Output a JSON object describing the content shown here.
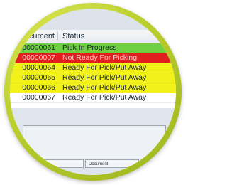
{
  "table": {
    "columns": [
      "ocument",
      "Status"
    ],
    "rows": [
      {
        "document": "00000061",
        "status": "Pick In Progress",
        "color": "#6fcf43"
      },
      {
        "document": "00000007",
        "status": "Not Ready For Picking",
        "color": "#e21f1f"
      },
      {
        "document": "00000064",
        "status": "Ready For Pick/Put Away",
        "color": "#f2f21a"
      },
      {
        "document": "00000065",
        "status": "Ready For Pick/Put Away",
        "color": "#f2f21a"
      },
      {
        "document": "00000066",
        "status": "Ready For Pick/Put Away",
        "color": "#f2f21a"
      },
      {
        "document": "00000067",
        "status": "Ready For Pick/Put Away",
        "color": "#ffffff"
      }
    ]
  },
  "bottom_tabs": [
    "Docume",
    "Document"
  ],
  "colors": {
    "ring": "#c3d630",
    "not_ready_text": "#ffd0d0"
  }
}
